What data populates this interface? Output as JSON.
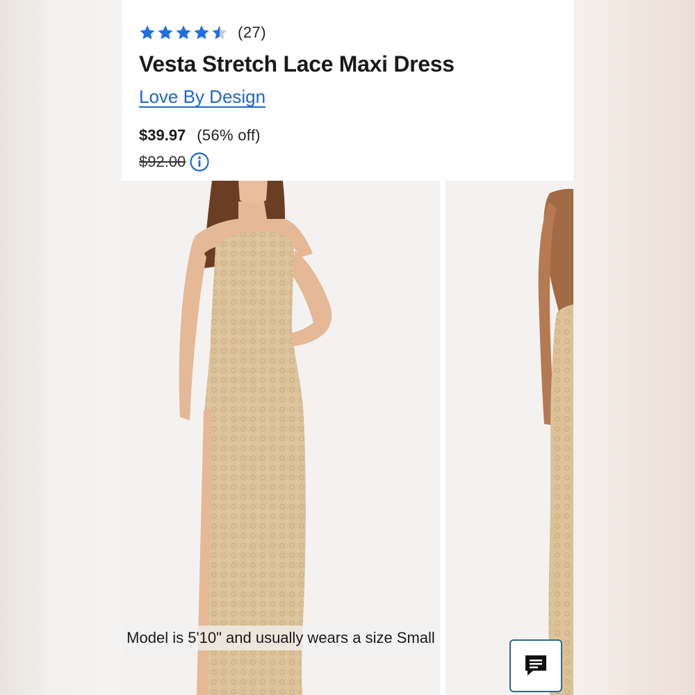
{
  "product": {
    "rating": 4.5,
    "rating_max": 5,
    "review_count": "(27)",
    "title": "Vesta Stretch Lace Maxi Dress",
    "brand": "Love By Design",
    "sale_price": "$39.97",
    "discount": "(56% off)",
    "original_price": "$92.00"
  },
  "gallery": {
    "model_caption": "Model is 5'10\" and usually wears a size Small",
    "images": [
      "model-front-image",
      "model-back-image"
    ]
  },
  "colors": {
    "star": "#1f6fe0",
    "star_empty": "#c8ccd2",
    "link": "#1f66c9",
    "dress": "#dcc29a",
    "chat_border": "#2d6a85"
  },
  "icons": {
    "info": "info-icon",
    "chat": "chat-icon",
    "star": "star-icon"
  }
}
